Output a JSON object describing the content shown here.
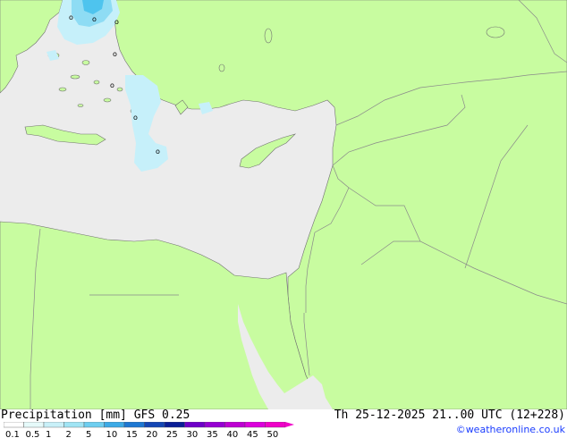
{
  "map": {
    "colors": {
      "sea": "#ececec",
      "land": "#c8fca0",
      "border": "#8a8a8a",
      "coast": "#707070",
      "precip_light": "#c6f0fa",
      "precip_med": "#8edcf4",
      "precip_heavy": "#4ec4ee"
    },
    "markers": [
      "o",
      "o",
      "o",
      "o",
      "o",
      "o",
      "o"
    ]
  },
  "footer": {
    "title": "Precipitation [mm]  GFS 0.25",
    "datetime": "Th 25-12-2025 21..00 UTC (12+228)",
    "credit": "©weatheronline.co.uk"
  },
  "legend": {
    "labels": [
      "0.1",
      "0.5",
      "1",
      "2",
      "5",
      "10",
      "15",
      "20",
      "25",
      "30",
      "35",
      "40",
      "45",
      "50"
    ],
    "colors": [
      "#ffffff",
      "#e6fafa",
      "#c8f0f8",
      "#a0e4f4",
      "#6ecef0",
      "#3caae6",
      "#1e78d2",
      "#1446b4",
      "#0a1e96",
      "#6e00c8",
      "#9600d2",
      "#be00d2",
      "#dc00dc",
      "#f000c8"
    ]
  }
}
